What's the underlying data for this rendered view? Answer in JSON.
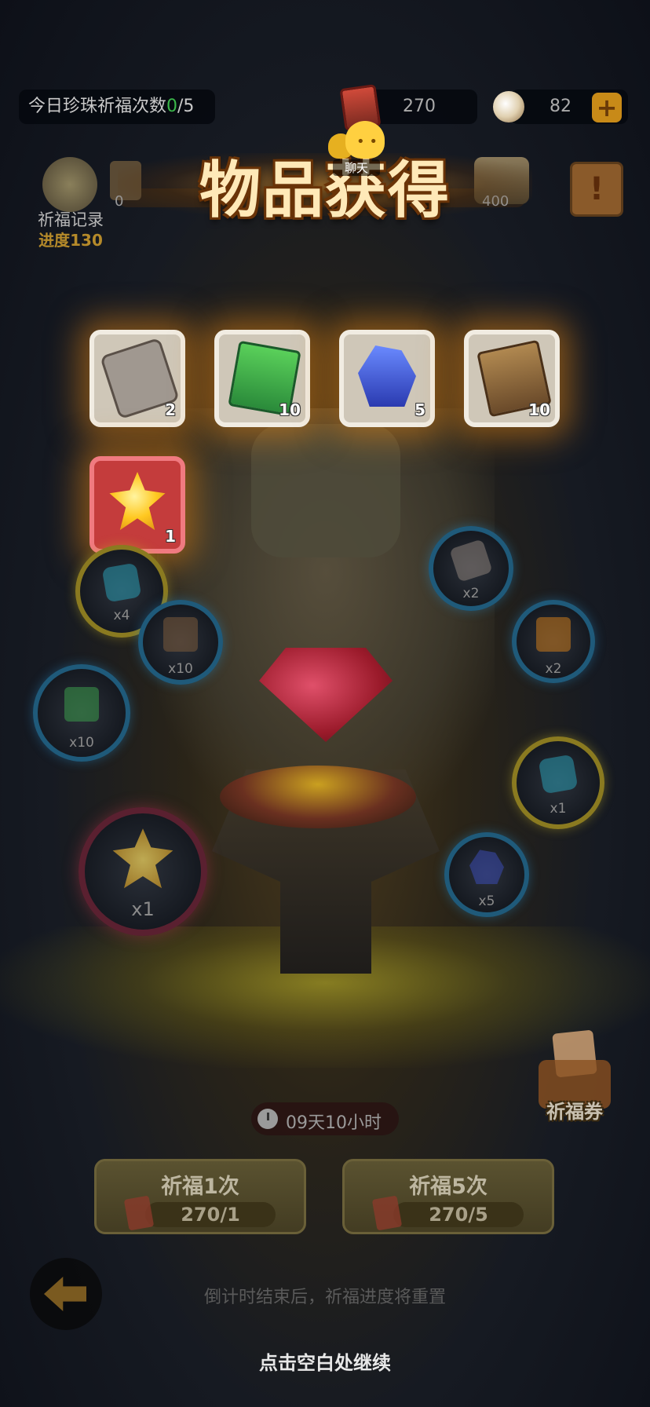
{
  "header": {
    "pray_count_prefix": "今日珍珠祈福次数",
    "pray_count_current": "0",
    "pray_count_suffix": "/5",
    "ticket_amount": "270",
    "pearl_amount": "82",
    "plus_icon": "+"
  },
  "progress": {
    "record_label": "祈福记录",
    "progress_label": "进度130",
    "small_chest_value": "0",
    "big_chest_value": "400",
    "rules_icon": "!"
  },
  "popup": {
    "title": "物品获得",
    "chat_label": "聊天",
    "chat_face": "• •",
    "rewards": [
      {
        "name": "stone-tablet-icon",
        "qty": "2"
      },
      {
        "name": "green-card-icon",
        "qty": "10"
      },
      {
        "name": "blue-crystal-icon",
        "qty": "5"
      },
      {
        "name": "scroll-icon",
        "qty": "10"
      },
      {
        "name": "gold-star-gem-icon",
        "qty": "1",
        "highlight": "#c43c3c"
      }
    ],
    "continue_hint": "点击空白处继续"
  },
  "wheel": {
    "orbs": [
      {
        "label": "x4"
      },
      {
        "label": "x10"
      },
      {
        "label": "x10"
      },
      {
        "label": "x1"
      },
      {
        "label": "x2"
      },
      {
        "label": "x2"
      },
      {
        "label": "x1"
      },
      {
        "label": "x5"
      }
    ]
  },
  "footer": {
    "voucher_label": "祈福券",
    "timer": "09天10小时",
    "pray_once_label": "祈福1次",
    "pray_once_cost": "270/1",
    "pray_five_label": "祈福5次",
    "pray_five_cost": "270/5",
    "reset_note": "倒计时结束后，祈福进度将重置"
  },
  "colors": {
    "accent_green": "#3bb84a",
    "gold": "#c88a18",
    "card_border": "#f1ece2"
  }
}
